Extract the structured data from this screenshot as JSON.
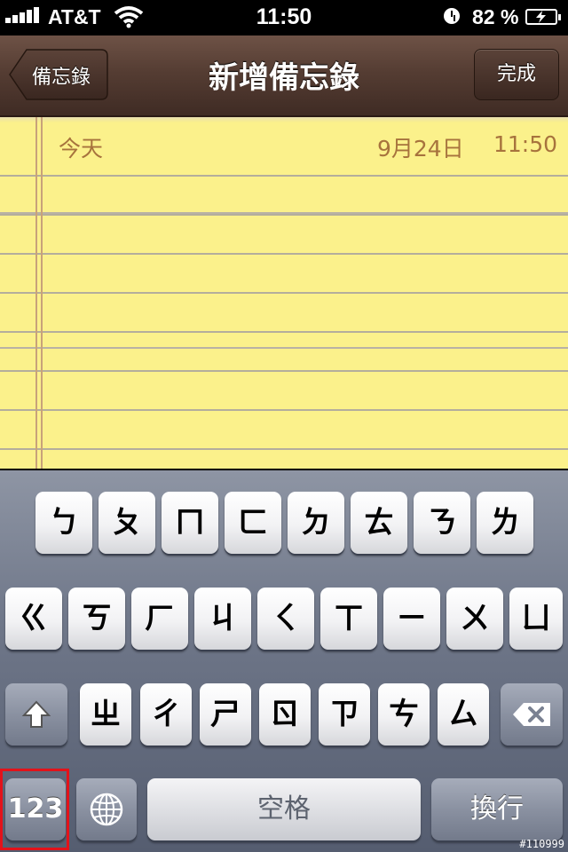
{
  "status_bar": {
    "carrier": "AT&T",
    "time": "11:50",
    "battery_percent": "82 %"
  },
  "nav": {
    "back_label": "備忘錄",
    "title": "新增備忘錄",
    "done_label": "完成"
  },
  "note": {
    "day_label": "今天",
    "date": "9月24日",
    "time": "11:50"
  },
  "keyboard": {
    "row1": [
      "ㄅ",
      "ㄆ",
      "ㄇ",
      "ㄈ",
      "ㄉ",
      "ㄊ",
      "ㄋ",
      "ㄌ"
    ],
    "row2": [
      "ㄍ",
      "ㄎ",
      "ㄏ",
      "ㄐ",
      "ㄑ",
      "ㄒ",
      "ㄧ",
      "ㄨ",
      "ㄩ"
    ],
    "row3": [
      "ㄓ",
      "ㄔ",
      "ㄕ",
      "ㄖ",
      "ㄗ",
      "ㄘ",
      "ㄙ"
    ],
    "numbers_label": "123",
    "space_label": "空格",
    "return_label": "換行",
    "icons": [
      "shift-icon",
      "globe-icon",
      "backspace-icon"
    ]
  },
  "watermark": "#110999",
  "colors": {
    "paper": "#fbf18b",
    "nav": "#553d33",
    "date_text": "#a7733d",
    "highlight": "#e3121a"
  }
}
